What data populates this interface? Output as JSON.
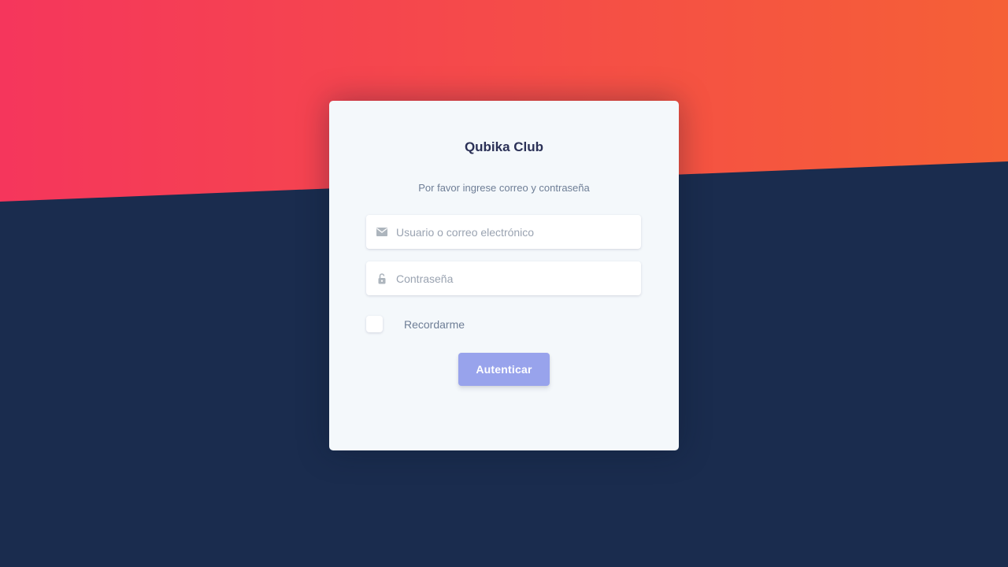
{
  "app": {
    "title": "Qubika Club"
  },
  "login": {
    "subtitle": "Por favor ingrese correo y contraseña",
    "email_placeholder": "Usuario o correo electrónico",
    "password_placeholder": "Contraseña",
    "remember_label": "Recordarme",
    "submit_label": "Autenticar",
    "remember_checked": false
  },
  "colors": {
    "gradient_start": "#f5365c",
    "gradient_end": "#f56036",
    "background": "#1a2c4e",
    "button": "#98a3ec",
    "card": "#f4f8fb"
  },
  "icons": {
    "email": "envelope-icon",
    "password": "lock-icon"
  }
}
